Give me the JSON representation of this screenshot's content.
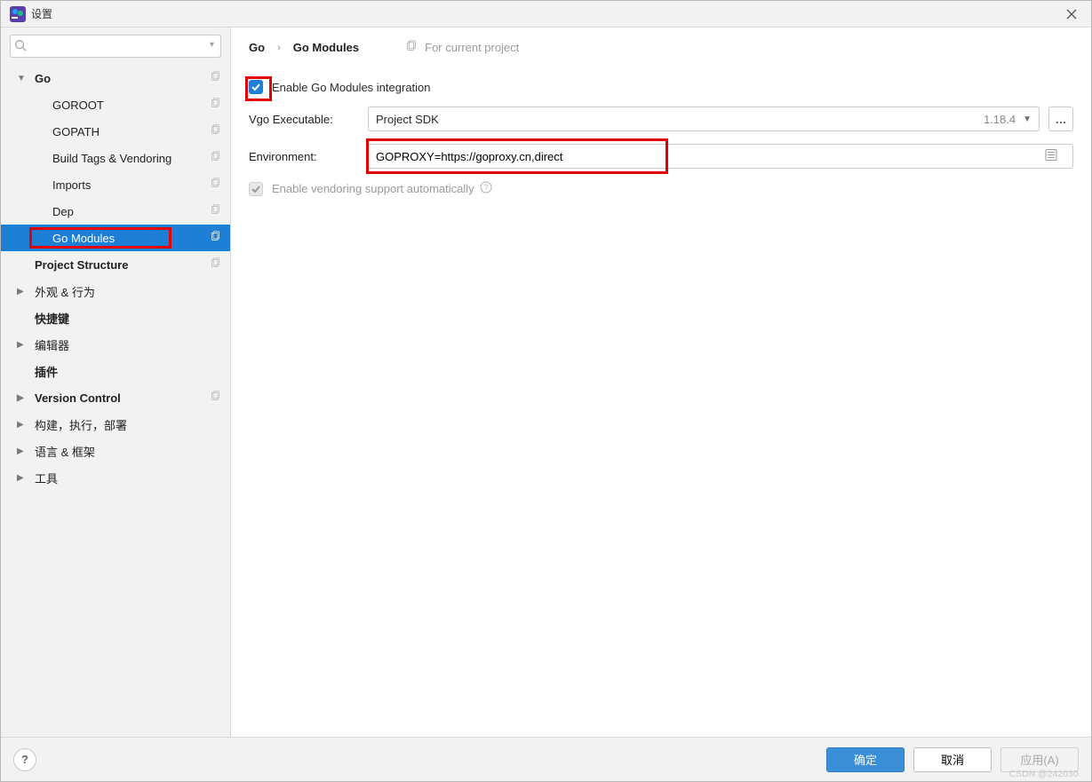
{
  "window": {
    "title": "设置"
  },
  "search": {
    "placeholder": ""
  },
  "sidebar": [
    {
      "label": "Go",
      "lvl": 1,
      "bold": true,
      "exp": "down",
      "copy": true
    },
    {
      "label": "GOROOT",
      "lvl": 2,
      "bold": false,
      "copy": true
    },
    {
      "label": "GOPATH",
      "lvl": 2,
      "bold": false,
      "copy": true
    },
    {
      "label": "Build Tags & Vendoring",
      "lvl": 2,
      "bold": false,
      "copy": true
    },
    {
      "label": "Imports",
      "lvl": 2,
      "bold": false,
      "copy": true
    },
    {
      "label": "Dep",
      "lvl": 2,
      "bold": false,
      "copy": true
    },
    {
      "label": "Go Modules",
      "lvl": 2,
      "bold": false,
      "sel": true,
      "copy": true,
      "ring": true
    },
    {
      "label": "Project Structure",
      "lvl": 1,
      "bold": true,
      "copy": true
    },
    {
      "label": "外观 & 行为",
      "lvl": 1,
      "bold": false,
      "exp": "right"
    },
    {
      "label": "快捷键",
      "lvl": 1,
      "bold": true
    },
    {
      "label": "编辑器",
      "lvl": 1,
      "bold": false,
      "exp": "right"
    },
    {
      "label": "插件",
      "lvl": 1,
      "bold": true
    },
    {
      "label": "Version Control",
      "lvl": 1,
      "bold": true,
      "exp": "right",
      "copy": true
    },
    {
      "label": "构建，执行，部署",
      "lvl": 1,
      "bold": false,
      "exp": "right"
    },
    {
      "label": "语言 & 框架",
      "lvl": 1,
      "bold": false,
      "exp": "right"
    },
    {
      "label": "工具",
      "lvl": 1,
      "bold": false,
      "exp": "right"
    }
  ],
  "breadcrumb": {
    "a": "Go",
    "b": "Go Modules",
    "scope": "For current project"
  },
  "form": {
    "enable_label": "Enable Go Modules integration",
    "vgo_label": "Vgo Executable:",
    "vgo_value": "Project SDK",
    "vgo_version": "1.18.4",
    "env_label": "Environment:",
    "env_value": "GOPROXY=https://goproxy.cn,direct",
    "vendor_label": "Enable vendoring support automatically"
  },
  "footer": {
    "ok": "确定",
    "cancel": "取消",
    "apply": "应用(A)"
  },
  "watermark": "CSDN @242030"
}
